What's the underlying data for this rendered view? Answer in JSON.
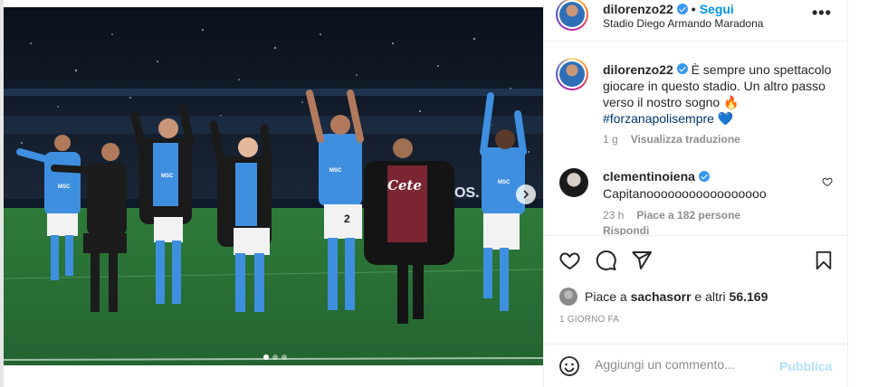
{
  "post_header": {
    "username": "dilorenzo22",
    "separator": "•",
    "follow_label": "Segui",
    "location": "Stadio Diego Armando Maradona",
    "more_icon": "more-horizontal-icon"
  },
  "caption": {
    "username": "dilorenzo22",
    "text": "È sempre uno spettacolo giocare in questo stadio. Un altro passo verso il nostro sogno",
    "emoji": "🔥",
    "hashtag": "#forzanapolisempre",
    "trailing_emoji": "💙",
    "time": "1 g",
    "translate_label": "Visualizza traduzione"
  },
  "comment": {
    "username": "clementinoiena",
    "text": "Capitanooooooooooooooooo",
    "time": "23 h",
    "likes_label": "Piace a 182 persone",
    "reply_label": "Rispondi"
  },
  "actions": {
    "like_icon": "heart-icon",
    "comment_icon": "comment-icon",
    "share_icon": "send-icon",
    "save_icon": "bookmark-icon"
  },
  "likes": {
    "prefix": "Piace a",
    "user": "sachasorr",
    "connector": "e altri",
    "count": "56.169"
  },
  "post_date": "1 GIORNO FA",
  "comment_box": {
    "placeholder": "Aggiungi un commento...",
    "publish_label": "Pubblica",
    "emoji_icon": "smiley-icon"
  },
  "carousel": {
    "total_slides": 3,
    "current_slide": 1,
    "next_icon": "chevron-right-icon"
  },
  "photo": {
    "sponsor_text": "Cete",
    "kit_text": "MSC",
    "ad_board_text": "CIOS.",
    "numbers": [
      "2",
      "2"
    ],
    "colors": {
      "kit": "#3f8fe0",
      "pitch": "#2f7d3a",
      "crowd": "#0e1726"
    }
  },
  "theme": {
    "link_blue": "#0095f6",
    "hashtag_blue": "#00376b",
    "muted": "#8e8e8e",
    "verified_blue": "#3897f0"
  }
}
